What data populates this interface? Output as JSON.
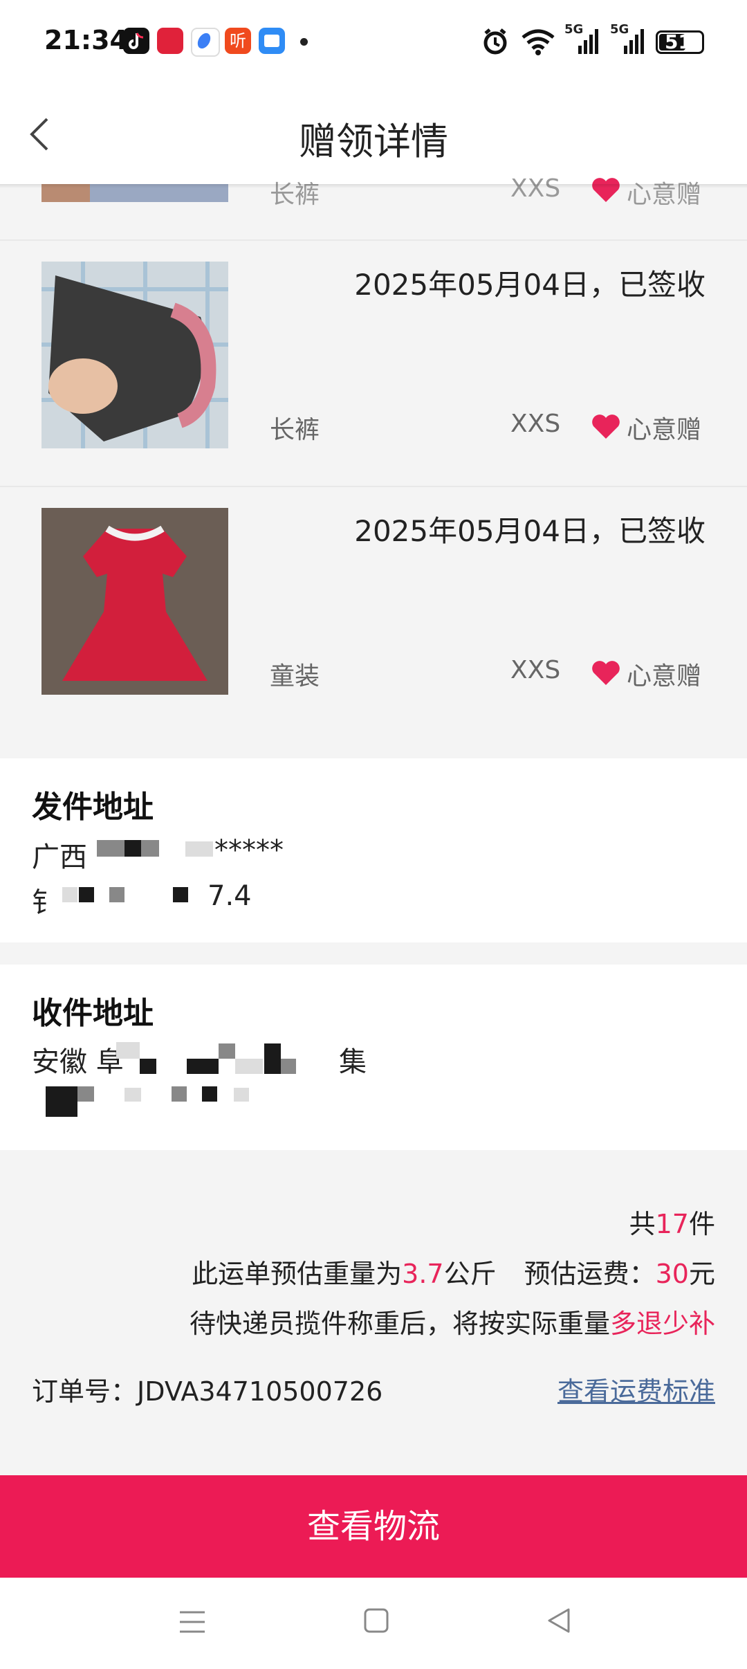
{
  "status_bar": {
    "time": "21:34",
    "network_label": "5G",
    "battery_level": "51",
    "icons": [
      "tiktok-icon",
      "app-red-icon",
      "app-blue-icon",
      "listen-icon",
      "file-icon",
      "alarm-icon",
      "wifi-icon",
      "signal-icon",
      "battery-icon"
    ]
  },
  "header": {
    "title": "赠领详情",
    "back_icon": "chevron-left-icon"
  },
  "items": [
    {
      "date": "",
      "category": "长裤",
      "size": "XXS",
      "tag": "心意赠"
    },
    {
      "date": "2025年05月04日，已签收",
      "category": "长裤",
      "size": "XXS",
      "tag": "心意赠"
    },
    {
      "date": "2025年05月04日，已签收",
      "category": "童装",
      "size": "XXS",
      "tag": "心意赠"
    }
  ],
  "sender": {
    "title": "发件地址",
    "line1": "广西",
    "line1_masked_tail": "*****",
    "line2": "钅",
    "line2_tail": "7.4"
  },
  "receiver": {
    "title": "收件地址",
    "line1": "安徽 阜",
    "line1_tail": "集"
  },
  "summary": {
    "count_prefix": "共",
    "count": "17",
    "count_suffix": "件",
    "weight_prefix": "此运单预估重量为",
    "weight": "3.7",
    "weight_unit": "公斤",
    "fee_label": "预估运费：",
    "fee": "30",
    "fee_unit": "元",
    "notice_prefix": "待快递员揽件称重后，将按实际重量",
    "notice_accent": "多退少补",
    "order_label": "订单号：",
    "order_no": "JDVA34710500726",
    "fee_link": "查看运费标准"
  },
  "cta": {
    "label": "查看物流"
  },
  "colors": {
    "accent": "#e8245a",
    "cta_bg": "#ec1b55",
    "link": "#4a6a9a"
  }
}
